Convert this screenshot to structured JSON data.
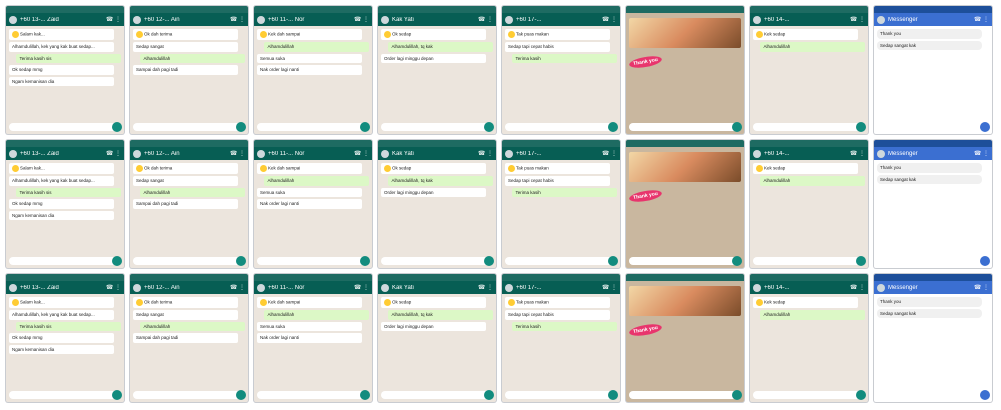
{
  "title": "Screenshot collage of chat conversations",
  "tiles": [
    {
      "kind": "wa",
      "header": "+60 13-... Zaid",
      "messages": [
        {
          "dir": "in",
          "text": "Salam kak..."
        },
        {
          "dir": "in",
          "text": "Alhamdulillah, kek yang kak buat sedap..."
        },
        {
          "dir": "out",
          "text": "Terima kasih sis"
        },
        {
          "dir": "in",
          "text": "Ok sedap mmg"
        },
        {
          "dir": "in",
          "text": "Ngam kemanisan dia"
        }
      ]
    },
    {
      "kind": "wa",
      "header": "+60 12-... Ain",
      "messages": [
        {
          "dir": "in",
          "text": "Ok dah terima"
        },
        {
          "dir": "in",
          "text": "Sedap sangat"
        },
        {
          "dir": "out",
          "text": "Alhamdulillah"
        },
        {
          "dir": "in",
          "text": "Sampai dah pagi tadi"
        }
      ]
    },
    {
      "kind": "wa",
      "header": "+60 11-... Nor",
      "messages": [
        {
          "dir": "in",
          "text": "Kek dah sampai"
        },
        {
          "dir": "out",
          "text": "Alhamdulillah"
        },
        {
          "dir": "in",
          "text": "Semua suka"
        },
        {
          "dir": "in",
          "text": "Nak order lagi nanti"
        }
      ]
    },
    {
      "kind": "wa",
      "header": "Kak Yati",
      "messages": [
        {
          "dir": "in",
          "text": "Ok sedap"
        },
        {
          "dir": "out",
          "text": "Alhamdulillah, tq kak"
        },
        {
          "dir": "in",
          "text": "Order lagi minggu depan"
        }
      ]
    },
    {
      "kind": "wa",
      "header": "+60 17-...",
      "messages": [
        {
          "dir": "in",
          "text": "Tak puas makan"
        },
        {
          "dir": "in",
          "text": "Sedap tapi cepat habis"
        },
        {
          "dir": "out",
          "text": "Terima kasih"
        }
      ]
    },
    {
      "kind": "pic",
      "header": "",
      "messages": [
        {
          "dir": "in",
          "text": "Thank you"
        }
      ]
    },
    {
      "kind": "wa",
      "header": "+60 14-...",
      "messages": [
        {
          "dir": "in",
          "text": "Kek sedap"
        },
        {
          "dir": "out",
          "text": "Alhamdulillah"
        }
      ]
    },
    {
      "kind": "fb",
      "header": "Messenger",
      "messages": [
        {
          "dir": "in",
          "text": "Thank you"
        },
        {
          "dir": "in",
          "text": "Sedap sangat kak"
        }
      ]
    }
  ]
}
